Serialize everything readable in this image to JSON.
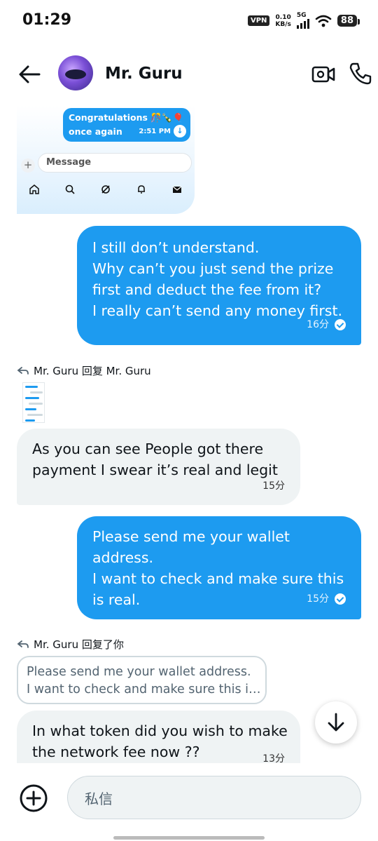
{
  "status_bar": {
    "time": "01:29",
    "vpn": "VPN",
    "speed_value": "0.10",
    "speed_unit": "KB/s",
    "network": "5G",
    "battery": "88"
  },
  "header": {
    "contact_name": "Mr. Guru",
    "icons": [
      "back-arrow-icon",
      "avatar",
      "video-call-icon",
      "phone-call-icon"
    ]
  },
  "embed": {
    "bubble_line1": "Congratulations 🎊🍾🎈",
    "bubble_line2": "once again",
    "bubble_time": "2:51 PM",
    "input_label": "Message"
  },
  "messages": {
    "m1": {
      "lines": [
        "I still don’t understand.",
        "Why can’t you just send the prize",
        "first and deduct the fee from it?",
        "I really can’t send any money first."
      ],
      "time": "16分"
    },
    "reply1": "Mr. Guru 回复 Mr. Guru",
    "m2": {
      "lines": [
        "As you can see People got there",
        "payment I swear it’s real and legit"
      ],
      "time": "15分"
    },
    "m3": {
      "lines": [
        "Please send me your wallet",
        "address.",
        "I want to check and make sure this",
        "is real."
      ],
      "time": "15分"
    },
    "reply2": "Mr. Guru 回复了你",
    "quote": {
      "line1": "Please send me your wallet address.",
      "line2": "I want to check and make sure this i…"
    },
    "m4": {
      "lines": [
        "In what token did you wish to make",
        "the network fee now ??"
      ],
      "time": "13分"
    }
  },
  "composer": {
    "placeholder": "私信"
  },
  "colors": {
    "accent": "#1d9bf0",
    "incoming_bubble": "#eff3f4"
  }
}
